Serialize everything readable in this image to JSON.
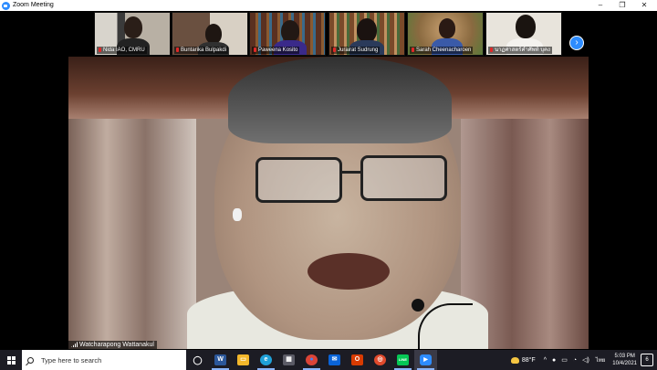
{
  "window": {
    "title": "Zoom Meeting",
    "controls": [
      "–",
      "❐",
      "✕"
    ]
  },
  "gallery": {
    "participants": [
      {
        "name": "Nida IAO, CMRU",
        "muted": true
      },
      {
        "name": "Buntarika Bulpakdi",
        "muted": true
      },
      {
        "name": "Paweena Kosito",
        "muted": true
      },
      {
        "name": "Jurairat Sudrung",
        "muted": true
      },
      {
        "name": "Sarah Cheenacharoen",
        "muted": true
      },
      {
        "name": "นาฏศาสตร์คำศัพท์ บุคง",
        "muted": true
      }
    ],
    "next_icon": "chevron-right-icon",
    "next_glyph": "›"
  },
  "main_video": {
    "speaker_name": "Watcharapong Wattanakul"
  },
  "taskbar": {
    "search_placeholder": "Type here to search",
    "icons": [
      {
        "name": "task-view-icon",
        "glyph": "◯",
        "color": "#1c1c24"
      },
      {
        "name": "word-icon",
        "glyph": "W",
        "color": "#2b579a"
      },
      {
        "name": "file-explorer-icon",
        "glyph": "▭",
        "color": "#f3b72b"
      },
      {
        "name": "edge-icon",
        "glyph": "e",
        "color": "#1fa1d8"
      },
      {
        "name": "store-icon",
        "glyph": "▦",
        "color": "#5b5b66"
      },
      {
        "name": "chrome-icon",
        "glyph": "●",
        "color": "#db4437"
      },
      {
        "name": "mail-icon",
        "glyph": "✉",
        "color": "#0a64d8"
      },
      {
        "name": "office-icon",
        "glyph": "O",
        "color": "#d83b01"
      },
      {
        "name": "app-icon",
        "glyph": "◎",
        "color": "#e04a2c"
      },
      {
        "name": "line-icon",
        "glyph": "LINE",
        "color": "#06c755"
      },
      {
        "name": "zoom-icon",
        "glyph": "▶",
        "color": "#2d8cff"
      }
    ],
    "weather": "88°F",
    "language": "ไทย",
    "time": "5:03 PM",
    "date": "10/4/2021",
    "notification_count": "6"
  }
}
